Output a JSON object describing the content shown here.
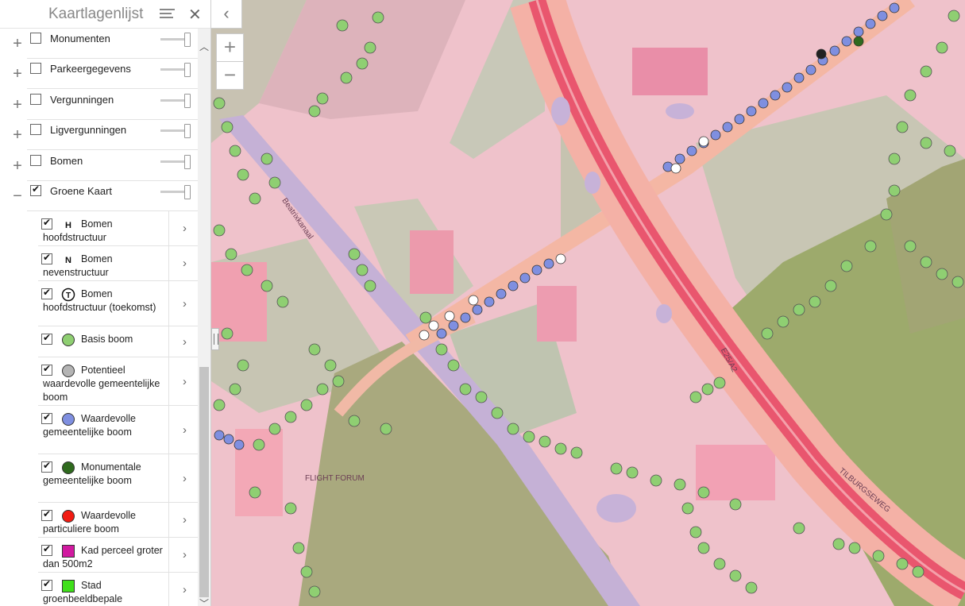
{
  "panel": {
    "title": "Kaartlagenlijst",
    "menu_icon": "hamburger-menu-icon",
    "close_icon": "close-icon",
    "collapse_icon": "chevron-left-icon"
  },
  "layers": [
    {
      "label": "Monumenten",
      "checked": false,
      "expanded": false
    },
    {
      "label": "Parkeergegevens",
      "checked": false,
      "expanded": false
    },
    {
      "label": "Vergunningen",
      "checked": false,
      "expanded": false
    },
    {
      "label": "Ligvergunningen",
      "checked": false,
      "expanded": false
    },
    {
      "label": "Bomen",
      "checked": false,
      "expanded": false
    },
    {
      "label": "Groene Kaart",
      "checked": true,
      "expanded": true
    }
  ],
  "legend": [
    {
      "label": "Bomen hoofdstructuur",
      "symbol": "H",
      "color": "#ffffff",
      "shape": "letter"
    },
    {
      "label": "Bomen nevenstructuur",
      "symbol": "N",
      "color": "#ffffff",
      "shape": "letter"
    },
    {
      "label": "Bomen hoofdstructuur (toekomst)",
      "symbol": "T",
      "color": "#ffffff",
      "shape": "circle-letter"
    },
    {
      "label": "Basis boom",
      "symbol": "",
      "color": "#8fcf72",
      "shape": "circle"
    },
    {
      "label": "Potentieel waardevolle gemeentelijke boom",
      "symbol": "",
      "color": "#b4b4b4",
      "shape": "circle"
    },
    {
      "label": "Waardevolle gemeentelijke boom",
      "symbol": "",
      "color": "#7f8fe0",
      "shape": "circle"
    },
    {
      "label": "Monumentale gemeentelijke boom",
      "symbol": "",
      "color": "#2f6a1e",
      "shape": "circle"
    },
    {
      "label": "Waardevolle particuliere boom",
      "symbol": "",
      "color": "#f21b12",
      "shape": "circle"
    },
    {
      "label": "Kad perceel groter dan 500m2",
      "symbol": "",
      "color": "#d11aa0",
      "shape": "square"
    },
    {
      "label": "Stad groenbeeldbepale",
      "symbol": "",
      "color": "#3fe01a",
      "shape": "square"
    }
  ],
  "map": {
    "zoom_in": "+",
    "zoom_out": "−",
    "labels": {
      "canal": "Beatrixkanaal",
      "highway": "E25/A2",
      "street": "TILBURGSEWEG",
      "area": "FLIGHT FORUM"
    }
  }
}
